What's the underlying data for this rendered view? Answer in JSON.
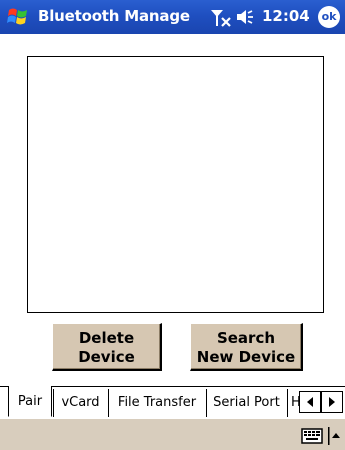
{
  "titlebar": {
    "app_title": "Bluetooth Manage",
    "clock": "12:04",
    "ok_label": "ok"
  },
  "buttons": {
    "delete_line1": "Delete",
    "delete_line2": "Device",
    "search_line1": "Search",
    "search_line2": "New Device"
  },
  "tabs": [
    {
      "label": "Pair"
    },
    {
      "label": "vCard"
    },
    {
      "label": "File Transfer"
    },
    {
      "label": "Serial Port"
    },
    {
      "label": "H"
    }
  ],
  "icons": {
    "start": "windows-flag-icon",
    "signal": "signal-off-icon",
    "speaker": "speaker-icon",
    "keyboard": "keyboard-icon",
    "tab_left": "arrow-left-icon",
    "tab_right": "arrow-right-icon",
    "sip": "arrow-up-icon"
  },
  "colors": {
    "titlebar": "#1f4fc0",
    "button_face": "#d6c7b2",
    "menubar": "#d8cdbd"
  }
}
